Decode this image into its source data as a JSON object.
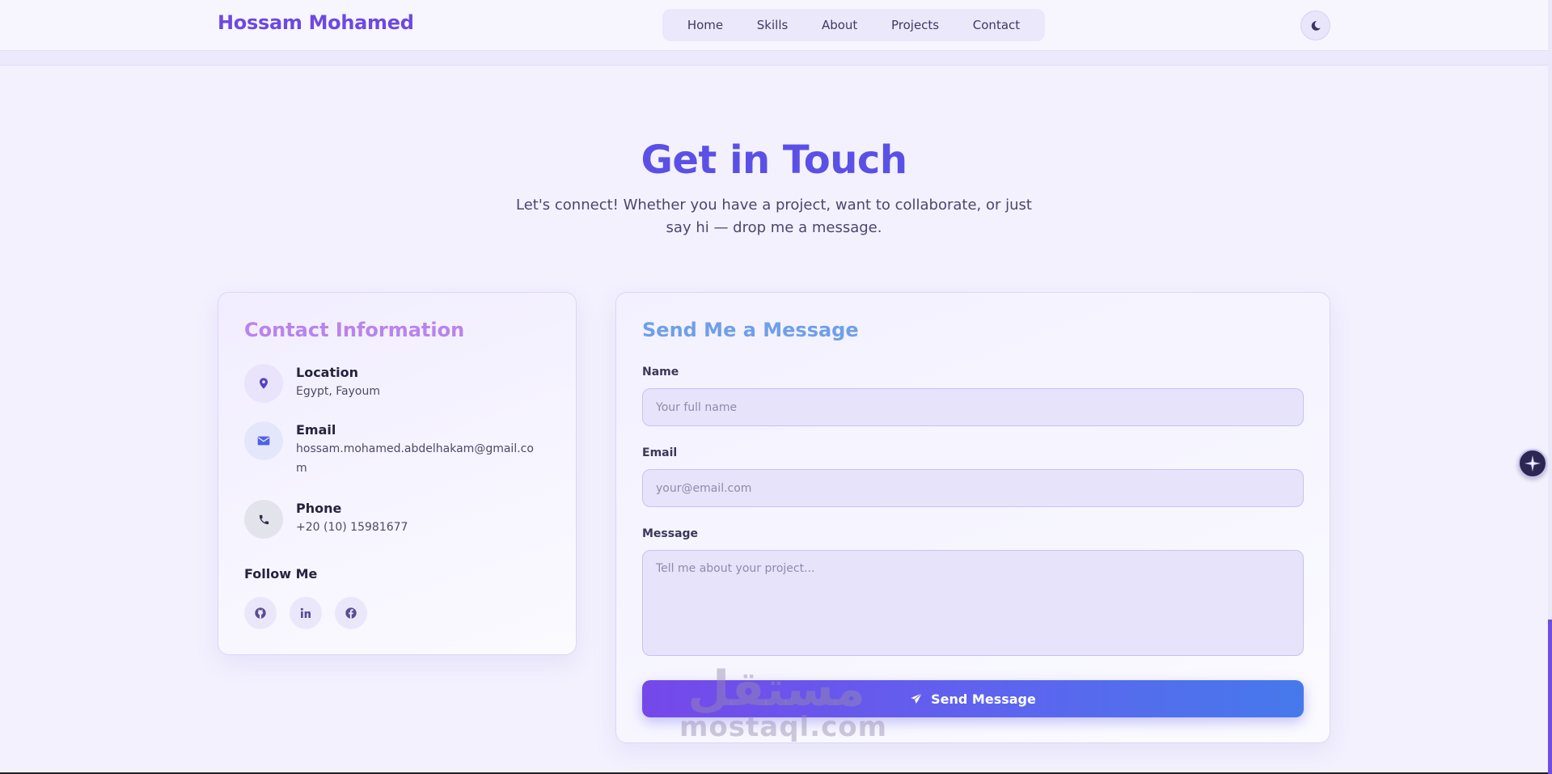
{
  "header": {
    "brand": "Hossam Mohamed",
    "nav": [
      "Home",
      "Skills",
      "About",
      "Projects",
      "Contact"
    ],
    "theme_icon": "moon-icon"
  },
  "hero": {
    "title": "Get in Touch",
    "subtitle": "Let's connect! Whether you have a project, want to collaborate, or just say hi — drop me a message."
  },
  "contact": {
    "title": "Contact Information",
    "items": [
      {
        "label": "Location",
        "value": "Egypt, Fayoum",
        "icon": "location-pin-icon",
        "icon_bg": "#e9e4fb",
        "icon_color": "#5a3fc4"
      },
      {
        "label": "Email",
        "value": "hossam.mohamed.abdelhakam@gmail.com",
        "icon": "envelope-icon",
        "icon_bg": "#e4e7fb",
        "icon_color": "#4f63e0"
      },
      {
        "label": "Phone",
        "value": "+20 (10) 15981677",
        "icon": "phone-icon",
        "icon_bg": "#e3e3ec",
        "icon_color": "#2e2c44"
      }
    ],
    "follow_label": "Follow Me",
    "socials": [
      {
        "icon": "github-icon"
      },
      {
        "icon": "linkedin-icon"
      },
      {
        "icon": "facebook-icon"
      }
    ]
  },
  "form": {
    "title": "Send Me a Message",
    "name_label": "Name",
    "name_placeholder": "Your full name",
    "email_label": "Email",
    "email_placeholder": "your@email.com",
    "message_label": "Message",
    "message_placeholder": "Tell me about your project...",
    "submit_label": "Send Message",
    "submit_icon": "paper-plane-icon"
  },
  "watermark": {
    "arabic": "مستقل",
    "latin": "mostaql.com"
  },
  "colors": {
    "brand": "#6d48e3",
    "title": "#5b50e6",
    "contact_title": "#b983ec",
    "message_title": "#6f9fe8",
    "button_start": "#7548ea",
    "button_end": "#4679ec"
  }
}
